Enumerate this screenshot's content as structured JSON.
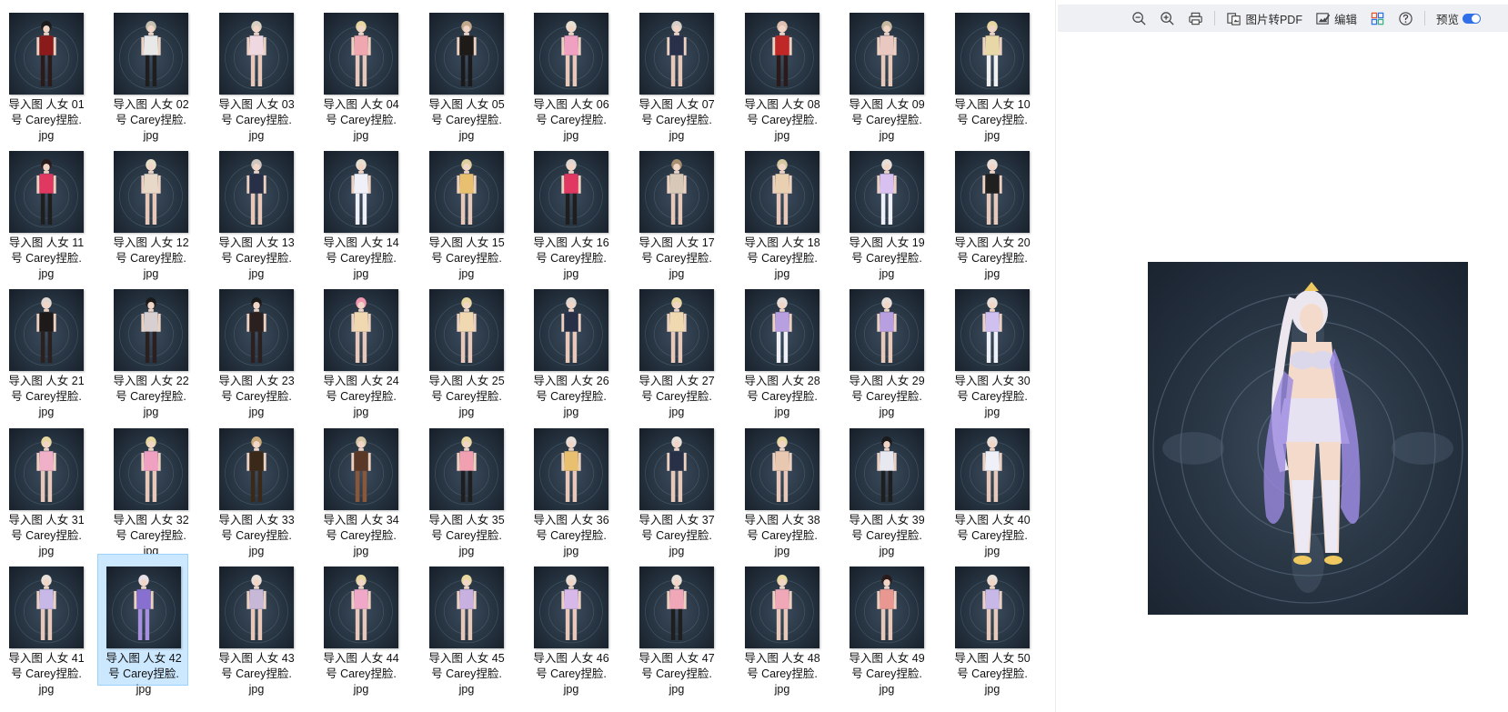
{
  "grid": {
    "selected_index": 41,
    "items": [
      {
        "line1": "导入图 人女 01",
        "line2": "号 Carey捏脸.",
        "line3": "jpg",
        "outfit": "#8b1a1a",
        "hair": "#1a1a1a",
        "legs": "#2a1a1a"
      },
      {
        "line1": "导入图 人女 02",
        "line2": "号 Carey捏脸.",
        "line3": "jpg",
        "outfit": "#e8e8e8",
        "hair": "#c8c0b0",
        "legs": "#1e1e1e"
      },
      {
        "line1": "导入图 人女 03",
        "line2": "号 Carey捏脸.",
        "line3": "jpg",
        "outfit": "#f0d8e0",
        "hair": "#d8d0c0",
        "legs": "#e8c8b8"
      },
      {
        "line1": "导入图 人女 04",
        "line2": "号 Carey捏脸.",
        "line3": "jpg",
        "outfit": "#f0a8b0",
        "hair": "#e8d8a0",
        "legs": "#e8c8b8"
      },
      {
        "line1": "导入图 人女 05",
        "line2": "号 Carey捏脸.",
        "line3": "jpg",
        "outfit": "#1e1a18",
        "hair": "#c0a888",
        "legs": "#1a1a1a"
      },
      {
        "line1": "导入图 人女 06",
        "line2": "号 Carey捏脸.",
        "line3": "jpg",
        "outfit": "#f0a0c0",
        "hair": "#e8e0d0",
        "legs": "#e8c8b8"
      },
      {
        "line1": "导入图 人女 07",
        "line2": "号 Carey捏脸.",
        "line3": "jpg",
        "outfit": "#28304a",
        "hair": "#d8d0c8",
        "legs": "#e8c8b8"
      },
      {
        "line1": "导入图 人女 08",
        "line2": "号 Carey捏脸.",
        "line3": "jpg",
        "outfit": "#c02828",
        "hair": "#e0c0b0",
        "legs": "#2a1a1a"
      },
      {
        "line1": "导入图 人女 09",
        "line2": "号 Carey捏脸.",
        "line3": "jpg",
        "outfit": "#e8c8c0",
        "hair": "#c8b8a0",
        "legs": "#e8c8b8"
      },
      {
        "line1": "导入图 人女 10",
        "line2": "号 Carey捏脸.",
        "line3": "jpg",
        "outfit": "#e8d8a8",
        "hair": "#e8d8a0",
        "legs": "#f0f0f0"
      },
      {
        "line1": "导入图 人女 11",
        "line2": "号 Carey捏脸.",
        "line3": "jpg",
        "outfit": "#e03860",
        "hair": "#2a1a1a",
        "legs": "#1e1e1e"
      },
      {
        "line1": "导入图 人女 12",
        "line2": "号 Carey捏脸.",
        "line3": "jpg",
        "outfit": "#e8d8c8",
        "hair": "#e8e0c8",
        "legs": "#e8c8b8"
      },
      {
        "line1": "导入图 人女 13",
        "line2": "号 Carey捏脸.",
        "line3": "jpg",
        "outfit": "#283048",
        "hair": "#d0c8c0",
        "legs": "#e8c8b8"
      },
      {
        "line1": "导入图 人女 14",
        "line2": "号 Carey捏脸.",
        "line3": "jpg",
        "outfit": "#f0f0f8",
        "hair": "#e8e0d0",
        "legs": "#f0f0f8"
      },
      {
        "line1": "导入图 人女 15",
        "line2": "号 Carey捏脸.",
        "line3": "jpg",
        "outfit": "#e8c070",
        "hair": "#e0d0a0",
        "legs": "#e8c8b8"
      },
      {
        "line1": "导入图 人女 16",
        "line2": "号 Carey捏脸.",
        "line3": "jpg",
        "outfit": "#e03860",
        "hair": "#e0d8d0",
        "legs": "#1e1e1e"
      },
      {
        "line1": "导入图 人女 17",
        "line2": "号 Carey捏脸.",
        "line3": "jpg",
        "outfit": "#d8c8b8",
        "hair": "#a89070",
        "legs": "#e8c8b8"
      },
      {
        "line1": "导入图 人女 18",
        "line2": "号 Carey捏脸.",
        "line3": "jpg",
        "outfit": "#e8d0b0",
        "hair": "#d8c8a0",
        "legs": "#e8c8b8"
      },
      {
        "line1": "导入图 人女 19",
        "line2": "号 Carey捏脸.",
        "line3": "jpg",
        "outfit": "#d8c0f0",
        "hair": "#e8e0d8",
        "legs": "#f0f0f8"
      },
      {
        "line1": "导入图 人女 20",
        "line2": "号 Carey捏脸.",
        "line3": "jpg",
        "outfit": "#202020",
        "hair": "#e8e0d8",
        "legs": "#e8c8b8"
      },
      {
        "line1": "导入图 人女 21",
        "line2": "号 Carey捏脸.",
        "line3": "jpg",
        "outfit": "#1e1a1a",
        "hair": "#e0d8d0",
        "legs": "#2a2020"
      },
      {
        "line1": "导入图 人女 22",
        "line2": "号 Carey捏脸.",
        "line3": "jpg",
        "outfit": "#d8d0d0",
        "hair": "#1a1a1a",
        "legs": "#2a2020"
      },
      {
        "line1": "导入图 人女 23",
        "line2": "号 Carey捏脸.",
        "line3": "jpg",
        "outfit": "#2a2020",
        "hair": "#1a1a1a",
        "legs": "#2a2020"
      },
      {
        "line1": "导入图 人女 24",
        "line2": "号 Carey捏脸.",
        "line3": "jpg",
        "outfit": "#f0d8b0",
        "hair": "#f098b0",
        "legs": "#e8c8b8"
      },
      {
        "line1": "导入图 人女 25",
        "line2": "号 Carey捏脸.",
        "line3": "jpg",
        "outfit": "#f0d8b0",
        "hair": "#e8d8a0",
        "legs": "#e8c8b8"
      },
      {
        "line1": "导入图 人女 26",
        "line2": "号 Carey捏脸.",
        "line3": "jpg",
        "outfit": "#283048",
        "hair": "#e0d8d0",
        "legs": "#e8c8b8"
      },
      {
        "line1": "导入图 人女 27",
        "line2": "号 Carey捏脸.",
        "line3": "jpg",
        "outfit": "#f0d8b0",
        "hair": "#e8d8a0",
        "legs": "#e8c8b8"
      },
      {
        "line1": "导入图 人女 28",
        "line2": "号 Carey捏脸.",
        "line3": "jpg",
        "outfit": "#b8a0e0",
        "hair": "#e8e0d8",
        "legs": "#f0f0f8"
      },
      {
        "line1": "导入图 人女 29",
        "line2": "号 Carey捏脸.",
        "line3": "jpg",
        "outfit": "#b8a0e0",
        "hair": "#e8e0d8",
        "legs": "#e8c8b8"
      },
      {
        "line1": "导入图 人女 30",
        "line2": "号 Carey捏脸.",
        "line3": "jpg",
        "outfit": "#d0c0f0",
        "hair": "#e8e0d8",
        "legs": "#f0f0f8"
      },
      {
        "line1": "导入图 人女 31",
        "line2": "号 Carey捏脸.",
        "line3": "jpg",
        "outfit": "#f0b0c8",
        "hair": "#e8d8a0",
        "legs": "#e8c8b8"
      },
      {
        "line1": "导入图 人女 32",
        "line2": "号 Carey捏脸.",
        "line3": "jpg",
        "outfit": "#f0a0c0",
        "hair": "#e8d8a0",
        "legs": "#e8c8b8"
      },
      {
        "line1": "导入图 人女 33",
        "line2": "号 Carey捏脸.",
        "line3": "jpg",
        "outfit": "#3a2818",
        "hair": "#c8a878",
        "legs": "#3a2818"
      },
      {
        "line1": "导入图 人女 34",
        "line2": "号 Carey捏脸.",
        "line3": "jpg",
        "outfit": "#5a3828",
        "hair": "#d8c8a8",
        "legs": "#8a5838"
      },
      {
        "line1": "导入图 人女 35",
        "line2": "号 Carey捏脸.",
        "line3": "jpg",
        "outfit": "#f0a0b0",
        "hair": "#e8d8a0",
        "legs": "#1e1e1e"
      },
      {
        "line1": "导入图 人女 36",
        "line2": "号 Carey捏脸.",
        "line3": "jpg",
        "outfit": "#e8c070",
        "hair": "#e8e0d8",
        "legs": "#e8c8b8"
      },
      {
        "line1": "导入图 人女 37",
        "line2": "号 Carey捏脸.",
        "line3": "jpg",
        "outfit": "#283048",
        "hair": "#e8e0d8",
        "legs": "#e8c8b8"
      },
      {
        "line1": "导入图 人女 38",
        "line2": "号 Carey捏脸.",
        "line3": "jpg",
        "outfit": "#e8c8b0",
        "hair": "#e8d8a0",
        "legs": "#e8c8b8"
      },
      {
        "line1": "导入图 人女 39",
        "line2": "号 Carey捏脸.",
        "line3": "jpg",
        "outfit": "#e8e8f0",
        "hair": "#1a1a1a",
        "legs": "#1e1e1e"
      },
      {
        "line1": "导入图 人女 40",
        "line2": "号 Carey捏脸.",
        "line3": "jpg",
        "outfit": "#f0f0f8",
        "hair": "#e8e0d8",
        "legs": "#e8c8b8"
      },
      {
        "line1": "导入图 人女 41",
        "line2": "号 Carey捏脸.",
        "line3": "jpg",
        "outfit": "#c8b8e8",
        "hair": "#e8e0d8",
        "legs": "#e8c8b8"
      },
      {
        "line1": "导入图 人女 42",
        "line2": "号 Carey捏脸.",
        "line3": "jpg",
        "outfit": "#8870d0",
        "hair": "#e8e0e8",
        "legs": "#a890e0"
      },
      {
        "line1": "导入图 人女 43",
        "line2": "号 Carey捏脸.",
        "line3": "jpg",
        "outfit": "#c8b8d8",
        "hair": "#e8e0d8",
        "legs": "#e8c8b8"
      },
      {
        "line1": "导入图 人女 44",
        "line2": "号 Carey捏脸.",
        "line3": "jpg",
        "outfit": "#f0a8c8",
        "hair": "#e8d8a0",
        "legs": "#e8c8b8"
      },
      {
        "line1": "导入图 人女 45",
        "line2": "号 Carey捏脸.",
        "line3": "jpg",
        "outfit": "#c8b0e0",
        "hair": "#e8d8a0",
        "legs": "#e8c8b8"
      },
      {
        "line1": "导入图 人女 46",
        "line2": "号 Carey捏脸.",
        "line3": "jpg",
        "outfit": "#d8b8e8",
        "hair": "#e8e0d8",
        "legs": "#e8c8b8"
      },
      {
        "line1": "导入图 人女 47",
        "line2": "号 Carey捏脸.",
        "line3": "jpg",
        "outfit": "#f0a8b8",
        "hair": "#e8e0d8",
        "legs": "#1e1e1e"
      },
      {
        "line1": "导入图 人女 48",
        "line2": "号 Carey捏脸.",
        "line3": "jpg",
        "outfit": "#f0a8b8",
        "hair": "#e8d8a0",
        "legs": "#e8c8b8"
      },
      {
        "line1": "导入图 人女 49",
        "line2": "号 Carey捏脸.",
        "line3": "jpg",
        "outfit": "#e89890",
        "hair": "#2a1a1a",
        "legs": "#e8c8b8"
      },
      {
        "line1": "导入图 人女 50",
        "line2": "号 Carey捏脸.",
        "line3": "jpg",
        "outfit": "#c8b8e8",
        "hair": "#e8e0d8",
        "legs": "#e8c8b8"
      }
    ]
  },
  "toolbar": {
    "zoom_out_icon": "zoom-out-icon",
    "zoom_in_icon": "zoom-in-icon",
    "print_icon": "print-icon",
    "to_pdf_label": "图片转PDF",
    "edit_label": "编辑",
    "apps_icon": "apps-grid-icon",
    "help_icon": "help-icon",
    "preview_label": "预览",
    "preview_enabled": true,
    "toggle_color": "#2f6fe8"
  },
  "preview": {
    "outfit": "#9b8ae0",
    "hair": "#ece6ee",
    "accent": "#f0c860"
  },
  "colors": {
    "selection_bg": "#cce8ff",
    "selection_border": "#99d1ff",
    "thumb_bg": "#25323f"
  }
}
